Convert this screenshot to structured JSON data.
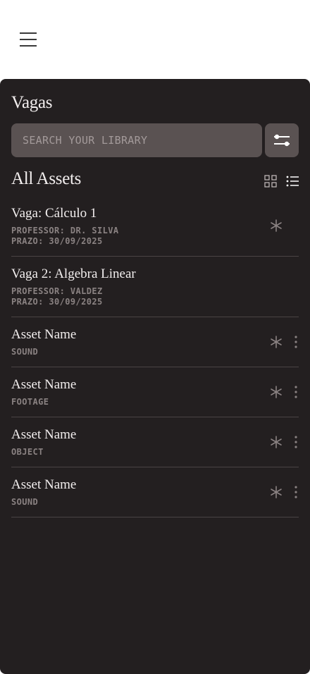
{
  "panel": {
    "title": "Vagas",
    "search_placeholder": "SEARCH YOUR LIBRARY",
    "section_title": "All Assets"
  },
  "icons": {
    "menu": "hamburger-menu-icon",
    "filter": "sliders-icon",
    "grid_view": "grid-view-icon",
    "list_view": "list-view-icon",
    "favorite": "asterisk-icon",
    "more": "more-vertical-icon"
  },
  "colors": {
    "panel_bg": "#231f20",
    "field_bg": "#5a5252",
    "text": "#f2eeee",
    "muted": "#8a8282"
  },
  "items": [
    {
      "title": "Vaga: Cálculo 1",
      "line1": "PROFESSOR: DR. SILVA",
      "line2": "PRAZO: 30/09/2025"
    },
    {
      "title": "Vaga 2: Algebra Linear",
      "line1": "PROFESSOR: VALDEZ",
      "line2": "PRAZO: 30/09/2025"
    },
    {
      "title": "Asset Name",
      "line1": "SOUND"
    },
    {
      "title": "Asset Name",
      "line1": "FOOTAGE"
    },
    {
      "title": "Asset Name",
      "line1": "OBJECT"
    },
    {
      "title": "Asset Name",
      "line1": "SOUND"
    }
  ]
}
